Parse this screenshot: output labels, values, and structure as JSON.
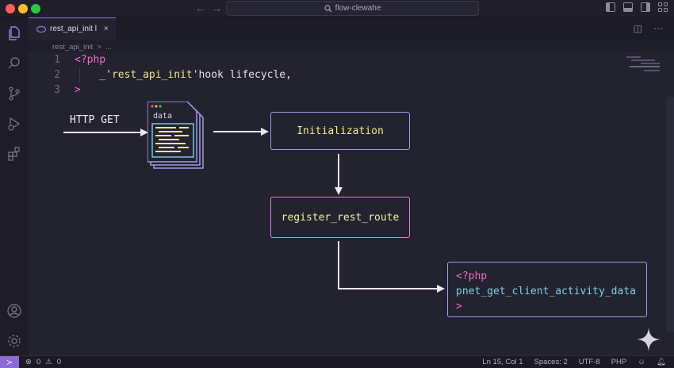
{
  "window": {
    "title": "flow-clewahe"
  },
  "tabs": [
    {
      "label": "rest_api_init l",
      "close": "×"
    }
  ],
  "breadcrumb": {
    "file": "rest_api_init",
    "sep": ">",
    "more": "..."
  },
  "code": [
    {
      "ln": "1",
      "parts": [
        {
          "t": "<?php",
          "c": "kw-pink"
        }
      ]
    },
    {
      "ln": "2",
      "parts": [
        {
          "t": "    _",
          "c": "plain"
        },
        {
          "t": "'rest_api_init'",
          "c": "str-yellow"
        },
        {
          "t": "hook lifecycle,",
          "c": "plain"
        }
      ]
    },
    {
      "ln": "3",
      "parts": [
        {
          "t": ">",
          "c": "kw-pink"
        }
      ]
    }
  ],
  "diagram": {
    "http": "HTTP GET",
    "data_label": "data",
    "init": "Initialization",
    "register": "register_rest_route",
    "php_open": "<?php",
    "php_func": "pnet_get_client_activity_data",
    "php_close": ">"
  },
  "status": {
    "errors": "0",
    "warnings": "0",
    "position": "Ln 15, Col 1",
    "spaces": "Spaces: 2",
    "encoding": "UTF-8",
    "language": "PHP"
  },
  "colors": {
    "accent": "#8d6bd6",
    "box_blue": "#9b9de8",
    "box_pink": "#e27ed8",
    "keyword": "#ee6ec9",
    "string": "#f0e68c"
  }
}
